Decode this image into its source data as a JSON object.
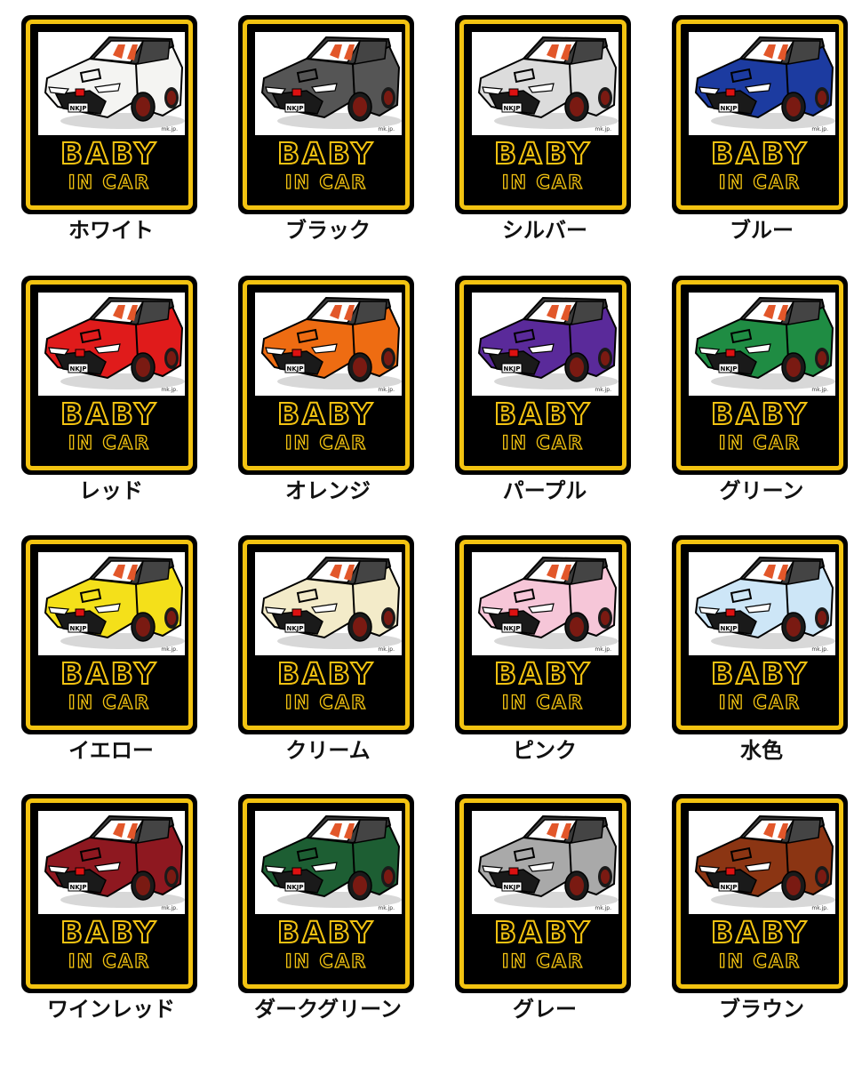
{
  "sticker": {
    "line1": "BABY",
    "line2": "IN CAR",
    "maker_mark": "mk.jp.",
    "plate": "NKJP",
    "frame_color": "#f3c311",
    "background_color": "#000000"
  },
  "variants": [
    {
      "label": "ホワイト",
      "body_color": "#f4f4f2"
    },
    {
      "label": "ブラック",
      "body_color": "#555555"
    },
    {
      "label": "シルバー",
      "body_color": "#dcdcdc"
    },
    {
      "label": "ブルー",
      "body_color": "#1c3ba0"
    },
    {
      "label": "レッド",
      "body_color": "#e01b1b"
    },
    {
      "label": "オレンジ",
      "body_color": "#ee6c12"
    },
    {
      "label": "パープル",
      "body_color": "#5a2a9a"
    },
    {
      "label": "グリーン",
      "body_color": "#1f8c43"
    },
    {
      "label": "イエロー",
      "body_color": "#f4e01a"
    },
    {
      "label": "クリーム",
      "body_color": "#f3ebc9"
    },
    {
      "label": "ピンク",
      "body_color": "#f6c6d8"
    },
    {
      "label": "水色",
      "body_color": "#cde6f7"
    },
    {
      "label": "ワインレッド",
      "body_color": "#8e1820"
    },
    {
      "label": "ダークグリーン",
      "body_color": "#1d5e33"
    },
    {
      "label": "グレー",
      "body_color": "#a9a9a9"
    },
    {
      "label": "ブラウン",
      "body_color": "#8b3513"
    }
  ]
}
